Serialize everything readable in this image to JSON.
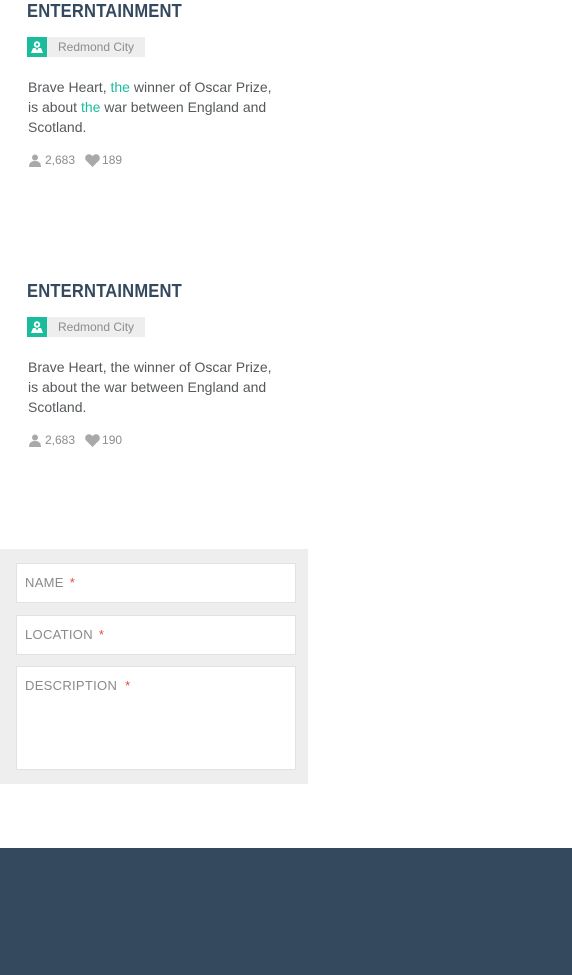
{
  "cards": [
    {
      "title": "ENTERNTAINMENT",
      "location": "Redmond City",
      "desc_parts": [
        "Brave Heart, ",
        "the",
        " winner of Oscar Prize, is about ",
        "the",
        " war between England and Scotland."
      ],
      "views": "2,683",
      "likes": "189"
    },
    {
      "title": "ENTERNTAINMENT",
      "location": "Redmond City",
      "desc_parts": [
        "Brave Heart, the winner of Oscar Prize, is about the war between England and Scotland."
      ],
      "views": "2,683",
      "likes": "190"
    }
  ],
  "form": {
    "name_label": "NAME",
    "location_label": "LOCATION",
    "description_label": "DESCRIPTION",
    "required_mark": "*"
  },
  "icons": {
    "location": "map-pin-icon",
    "views": "user-icon",
    "likes": "heart-icon"
  },
  "colors": {
    "accent": "#1abc9c",
    "title": "#34495e",
    "required": "#e74c3c",
    "footer": "#34495e"
  }
}
